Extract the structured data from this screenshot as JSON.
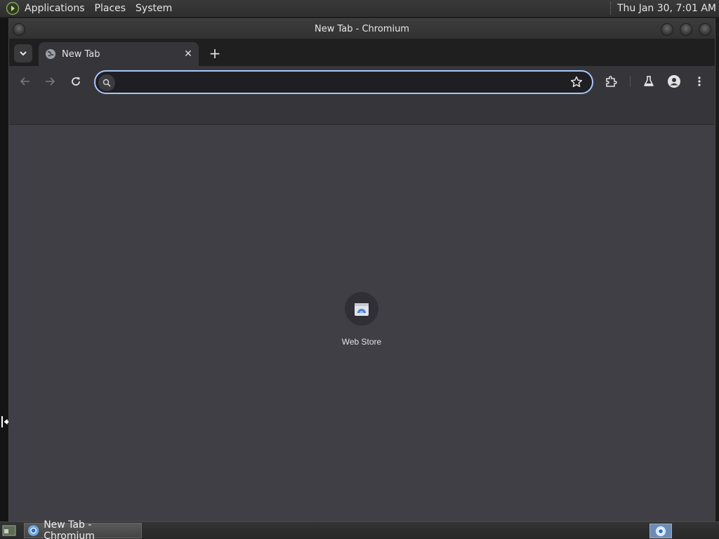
{
  "top_panel": {
    "menus": [
      "Applications",
      "Places",
      "System"
    ],
    "clock": "Thu Jan 30,  7:01 AM"
  },
  "window": {
    "title": "New Tab - Chromium"
  },
  "tabs": [
    {
      "label": "New Tab",
      "close": "✕"
    }
  ],
  "tabstrip": {
    "new_tab": "+"
  },
  "omnibox": {
    "value": "",
    "placeholder": ""
  },
  "shortcuts": [
    {
      "label": "Web Store"
    }
  ],
  "taskbar": {
    "items": [
      {
        "label": "New Tab - Chromium"
      }
    ]
  },
  "colors": {
    "focus_ring": "#a8c7fa",
    "content_bg": "#3f3f45",
    "toolbar_bg": "#36363a"
  }
}
